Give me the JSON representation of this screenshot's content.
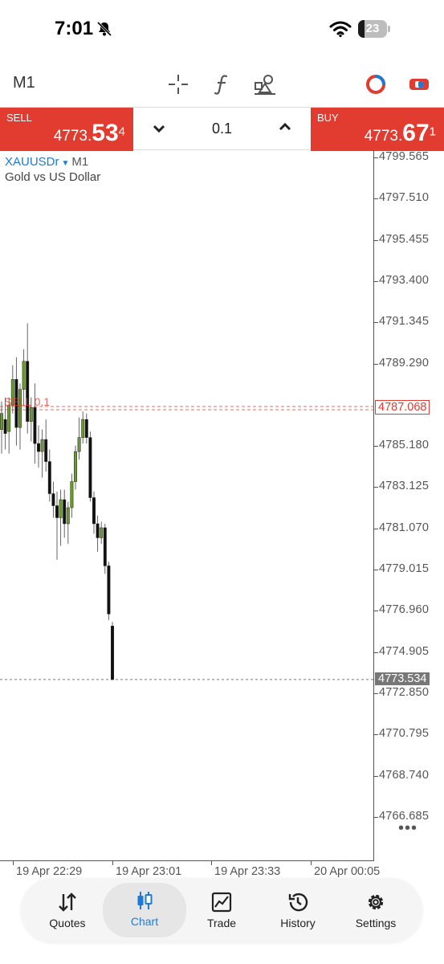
{
  "status_bar": {
    "time": "7:01",
    "battery": "23"
  },
  "toolbar": {
    "timeframe": "M1"
  },
  "trade": {
    "sell_label": "SELL",
    "sell_price_prefix": "4773.",
    "sell_price_big": "53",
    "sell_price_sup": "4",
    "buy_label": "BUY",
    "buy_price_prefix": "4773.",
    "buy_price_big": "67",
    "buy_price_sup": "1",
    "lot": "0.1"
  },
  "chart": {
    "symbol": "XAUUSDr",
    "timeframe": "M1",
    "description": "Gold vs US Dollar",
    "y_labels": [
      "4799.565",
      "4797.510",
      "4795.455",
      "4793.400",
      "4791.345",
      "4789.290",
      "4785.180",
      "4783.125",
      "4781.070",
      "4779.015",
      "4776.960",
      "4774.905",
      "4772.850",
      "4770.795",
      "4768.740",
      "4766.685"
    ],
    "order_label": "SELL 0.1",
    "order_price": "4787.068",
    "bid_price": "4773.534",
    "x_labels": [
      "19 Apr 22:29",
      "19 Apr 23:01",
      "19 Apr 23:33",
      "20 Apr 00:05"
    ]
  },
  "chart_data": {
    "type": "candlestick",
    "symbol": "XAUUSDr",
    "timeframe": "M1",
    "ylim": [
      4765.7,
      4800.0
    ],
    "candles": [
      {
        "o": 4786.0,
        "h": 4787.4,
        "l": 4784.8,
        "c": 4786.8
      },
      {
        "o": 4786.5,
        "h": 4787.6,
        "l": 4785.0,
        "c": 4785.8
      },
      {
        "o": 4785.9,
        "h": 4787.6,
        "l": 4784.8,
        "c": 4787.2
      },
      {
        "o": 4787.2,
        "h": 4789.2,
        "l": 4786.8,
        "c": 4788.5
      },
      {
        "o": 4788.5,
        "h": 4789.6,
        "l": 4785.2,
        "c": 4786.1
      },
      {
        "o": 4786.1,
        "h": 4788.3,
        "l": 4785.0,
        "c": 4788.0
      },
      {
        "o": 4788.0,
        "h": 4790.0,
        "l": 4787.2,
        "c": 4789.4
      },
      {
        "o": 4789.4,
        "h": 4791.3,
        "l": 4785.8,
        "c": 4786.4
      },
      {
        "o": 4786.4,
        "h": 4787.6,
        "l": 4785.4,
        "c": 4787.1
      },
      {
        "o": 4787.1,
        "h": 4788.3,
        "l": 4784.3,
        "c": 4785.3
      },
      {
        "o": 4785.3,
        "h": 4786.2,
        "l": 4784.1,
        "c": 4784.9
      },
      {
        "o": 4784.9,
        "h": 4786.0,
        "l": 4783.6,
        "c": 4785.5
      },
      {
        "o": 4785.5,
        "h": 4786.5,
        "l": 4783.9,
        "c": 4784.4
      },
      {
        "o": 4784.4,
        "h": 4785.0,
        "l": 4782.4,
        "c": 4782.8
      },
      {
        "o": 4782.8,
        "h": 4783.4,
        "l": 4781.6,
        "c": 4782.2
      },
      {
        "o": 4782.2,
        "h": 4782.9,
        "l": 4779.5,
        "c": 4781.6
      },
      {
        "o": 4781.6,
        "h": 4783.0,
        "l": 4780.2,
        "c": 4782.5
      },
      {
        "o": 4782.5,
        "h": 4783.0,
        "l": 4780.6,
        "c": 4781.3
      },
      {
        "o": 4781.3,
        "h": 4782.4,
        "l": 4780.3,
        "c": 4782.1
      },
      {
        "o": 4782.1,
        "h": 4783.8,
        "l": 4781.6,
        "c": 4783.4
      },
      {
        "o": 4783.4,
        "h": 4785.2,
        "l": 4783.0,
        "c": 4784.9
      },
      {
        "o": 4784.9,
        "h": 4786.6,
        "l": 4784.5,
        "c": 4785.6
      },
      {
        "o": 4785.6,
        "h": 4786.9,
        "l": 4785.3,
        "c": 4786.5
      },
      {
        "o": 4786.5,
        "h": 4786.8,
        "l": 4785.3,
        "c": 4785.6
      },
      {
        "o": 4785.6,
        "h": 4785.9,
        "l": 4782.4,
        "c": 4782.6
      },
      {
        "o": 4782.6,
        "h": 4782.9,
        "l": 4780.8,
        "c": 4781.3
      },
      {
        "o": 4781.3,
        "h": 4781.7,
        "l": 4779.9,
        "c": 4780.6
      },
      {
        "o": 4780.6,
        "h": 4781.4,
        "l": 4780.3,
        "c": 4781.1
      },
      {
        "o": 4781.1,
        "h": 4781.3,
        "l": 4778.8,
        "c": 4779.2
      },
      {
        "o": 4779.2,
        "h": 4779.4,
        "l": 4776.5,
        "c": 4776.8
      },
      {
        "o": 4776.2,
        "h": 4776.4,
        "l": 4773.5,
        "c": 4773.53
      }
    ]
  },
  "nav": [
    {
      "label": "Quotes",
      "icon": "quotes-icon"
    },
    {
      "label": "Chart",
      "icon": "chart-icon"
    },
    {
      "label": "Trade",
      "icon": "trade-icon"
    },
    {
      "label": "History",
      "icon": "history-icon"
    },
    {
      "label": "Settings",
      "icon": "settings-icon"
    }
  ],
  "colors": {
    "sell": "#e23b30",
    "buy": "#e23b30",
    "bull": "#6a9a2e",
    "bear": "#111111",
    "accent": "#1f7ad6"
  }
}
